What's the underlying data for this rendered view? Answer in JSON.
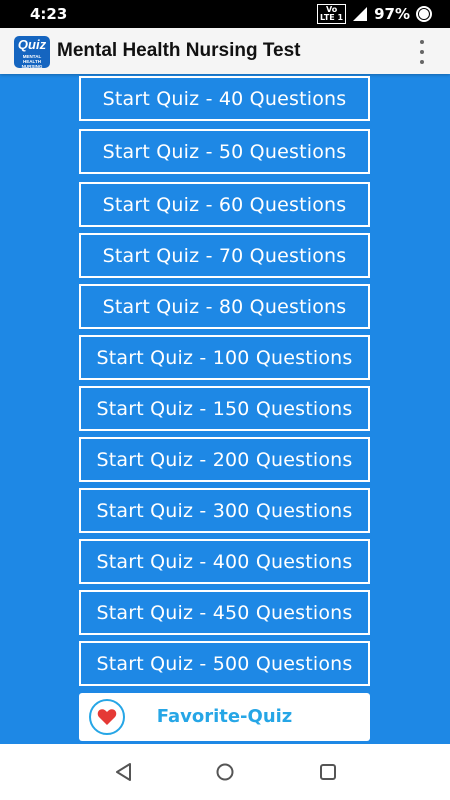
{
  "status": {
    "time": "4:23",
    "volte": "Vo",
    "lte": "LTE 1",
    "battery": "97%"
  },
  "app": {
    "title": "Mental Health Nursing Test",
    "logo_text": "Quiz",
    "logo_sub": "MENTAL HEALTH NURSING"
  },
  "quiz_buttons": [
    "Start Quiz - 40 Questions",
    "Start Quiz - 50 Questions",
    "Start Quiz - 60 Questions",
    "Start Quiz - 70 Questions",
    "Start Quiz - 80 Questions",
    "Start Quiz - 100 Questions",
    "Start Quiz - 150 Questions",
    "Start Quiz - 200 Questions",
    "Start Quiz - 300 Questions",
    "Start Quiz - 400 Questions",
    "Start Quiz - 450 Questions",
    "Start Quiz - 500 Questions"
  ],
  "favorite": {
    "label": "Favorite-Quiz",
    "icon": "heart-icon"
  },
  "colors": {
    "background": "#1e88e5",
    "accent": "#26a6e6",
    "heart": "#e53935"
  }
}
